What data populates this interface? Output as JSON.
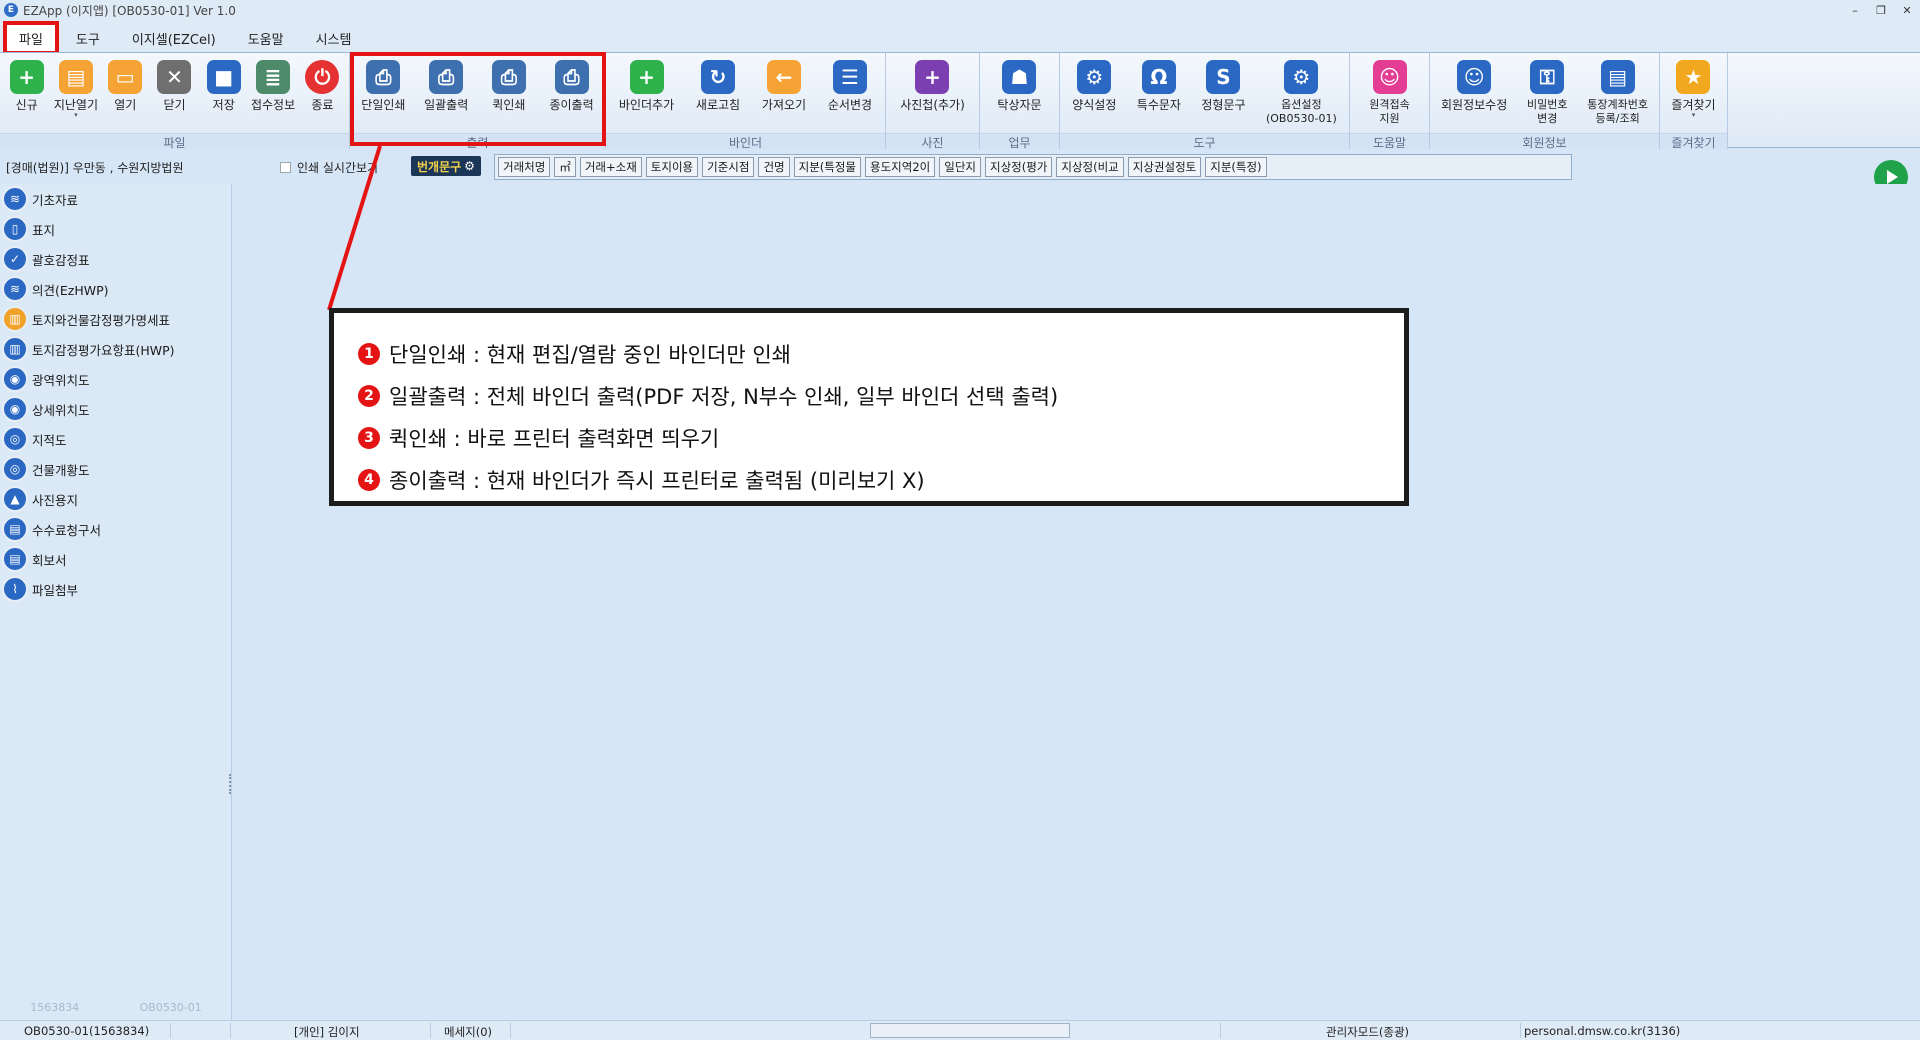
{
  "window": {
    "title": "EZApp (이지앱) [OB0530-01] Ver 1.0",
    "controls": [
      "–",
      "❐",
      "✕"
    ]
  },
  "menu_tabs": [
    "파일",
    "도구",
    "이지셀(EZCel)",
    "도움말",
    "시스템"
  ],
  "ribbon": {
    "groups": [
      {
        "label": "파일",
        "buttons": [
          {
            "label": "신규",
            "icon": "plus-icon",
            "glyph": "+"
          },
          {
            "label": "지난열기",
            "icon": "folder-history-icon",
            "glyph": "▤"
          },
          {
            "label": "열기",
            "icon": "folder-open-icon",
            "glyph": "▭"
          },
          {
            "label": "닫기",
            "icon": "close-icon",
            "glyph": "✕"
          },
          {
            "label": "저장",
            "icon": "save-icon",
            "glyph": "■"
          },
          {
            "label": "접수정보",
            "icon": "receipt-icon",
            "glyph": "≣"
          },
          {
            "label": "종료",
            "icon": "power-icon",
            "glyph": "⏻"
          }
        ]
      },
      {
        "label": "출력",
        "buttons": [
          {
            "label": "단일인쇄",
            "icon": "print-single-icon",
            "glyph": "⎙"
          },
          {
            "label": "일괄출력",
            "icon": "print-all-icon",
            "glyph": "⎙"
          },
          {
            "label": "퀵인쇄",
            "icon": "print-quick-icon",
            "glyph": "⎙"
          },
          {
            "label": "종이출력",
            "icon": "print-paper-icon",
            "glyph": "⎙"
          }
        ]
      },
      {
        "label": "바인더",
        "buttons": [
          {
            "label": "바인더추가",
            "icon": "binder-add-icon",
            "glyph": "+"
          },
          {
            "label": "새로고침",
            "icon": "refresh-icon",
            "glyph": "↻"
          },
          {
            "label": "가져오기",
            "icon": "import-icon",
            "glyph": "←"
          },
          {
            "label": "순서변경",
            "icon": "reorder-icon",
            "glyph": "☰"
          }
        ]
      },
      {
        "label": "사진",
        "buttons": [
          {
            "label": "사진첩(추가)",
            "icon": "photo-album-icon",
            "glyph": "+"
          }
        ]
      },
      {
        "label": "업무",
        "buttons": [
          {
            "label": "탁상자문",
            "icon": "consult-icon",
            "glyph": "☗"
          }
        ]
      },
      {
        "label": "도구",
        "buttons": [
          {
            "label": "양식설정",
            "icon": "form-settings-icon",
            "glyph": "⚙"
          },
          {
            "label": "특수문자",
            "icon": "special-char-icon",
            "glyph": "Ω"
          },
          {
            "label": "정형문구",
            "icon": "phrase-icon",
            "glyph": "S"
          },
          {
            "label": "옵션설정\n(OB0530-01)",
            "icon": "option-settings-icon",
            "glyph": "⚙"
          }
        ]
      },
      {
        "label": "도움말",
        "buttons": [
          {
            "label": "원격접속\n지원",
            "icon": "remote-support-icon",
            "glyph": "☺"
          }
        ]
      },
      {
        "label": "회원정보",
        "buttons": [
          {
            "label": "회원정보수정",
            "icon": "member-edit-icon",
            "glyph": "☺"
          },
          {
            "label": "비밀번호\n변경",
            "icon": "password-icon",
            "glyph": "⚿"
          },
          {
            "label": "통장계좌번호\n등록/조회",
            "icon": "bank-account-icon",
            "glyph": "▤"
          }
        ]
      },
      {
        "label": "즐겨찾기",
        "buttons": [
          {
            "label": "즐겨찾기",
            "icon": "star-icon",
            "glyph": "★"
          }
        ]
      }
    ]
  },
  "subbar": {
    "court": "[경매(법원)] 우만동 , 수원지방법원",
    "realtime_label": "인쇄 실시간보기",
    "phrase_button": "번개문구",
    "phrases": [
      "거래처명",
      "㎡",
      "거래+소재",
      "토지이용",
      "기준시점",
      "건명",
      "지분(특정물",
      "용도지역2이",
      "일단지",
      "지상정(평가",
      "지상정(비교",
      "지상권설정토",
      "지분(특정)"
    ]
  },
  "sidebar": {
    "items": [
      {
        "label": "기초자료",
        "icon": "layers-icon",
        "glyph": "≋",
        "color": "#2a68c3"
      },
      {
        "label": "표지",
        "icon": "cover-icon",
        "glyph": "▯",
        "color": "#2a68c3"
      },
      {
        "label": "괄호감정표",
        "icon": "appraisal-icon",
        "glyph": "✓",
        "color": "#2a68c3"
      },
      {
        "label": "의견(EzHWP)",
        "icon": "opinion-icon",
        "glyph": "≋",
        "color": "#2a68c3"
      },
      {
        "label": "토지와건물감정평가명세표",
        "icon": "land-building-icon",
        "glyph": "▥",
        "color": "#f0a22b"
      },
      {
        "label": "토지감정평가요항표(HWP)",
        "icon": "map-book-icon",
        "glyph": "▥",
        "color": "#2a68c3"
      },
      {
        "label": "광역위치도",
        "icon": "location-icon",
        "glyph": "◉",
        "color": "#2a68c3"
      },
      {
        "label": "상세위치도",
        "icon": "location-detail-icon",
        "glyph": "◉",
        "color": "#2a68c3"
      },
      {
        "label": "지적도",
        "icon": "globe-icon",
        "glyph": "◎",
        "color": "#2a68c3"
      },
      {
        "label": "건물개황도",
        "icon": "building-icon",
        "glyph": "◎",
        "color": "#2a68c3"
      },
      {
        "label": "사진용지",
        "icon": "photo-icon",
        "glyph": "▲",
        "color": "#2a68c3"
      },
      {
        "label": "수수료청구서",
        "icon": "invoice-icon",
        "glyph": "▤",
        "color": "#2a68c3"
      },
      {
        "label": "회보서",
        "icon": "clipboard-icon",
        "glyph": "▤",
        "color": "#2a68c3"
      },
      {
        "label": "파일첨부",
        "icon": "paperclip-icon",
        "glyph": "⌇",
        "color": "#2a68c3"
      }
    ],
    "footer": [
      "1563834",
      "OB0530-01"
    ]
  },
  "callout": {
    "items": [
      {
        "num": "1",
        "text": "단일인쇄 : 현재 편집/열람 중인 바인더만 인쇄"
      },
      {
        "num": "2",
        "text": "일괄출력 : 전체 바인더 출력(PDF 저장, N부수 인쇄, 일부 바인더 선택 출력)"
      },
      {
        "num": "3",
        "text": "퀵인쇄 : 바로 프린터 출력화면 띄우기"
      },
      {
        "num": "4",
        "text": "종이출력 : 현재 바인더가 즉시 프린터로 출력됨 (미리보기 X)"
      }
    ]
  },
  "statusbar": {
    "session": "OB0530-01(1563834)",
    "user": "[개인] 김이지",
    "messages": "메세지(0)",
    "mode": "관리자모드(종광)",
    "server": "personal.dmsw.co.kr(3136)"
  },
  "colors": {
    "highlight": "#e41414",
    "ribbon_bg": "#dde9f6",
    "accent_blue": "#2a68c3"
  }
}
